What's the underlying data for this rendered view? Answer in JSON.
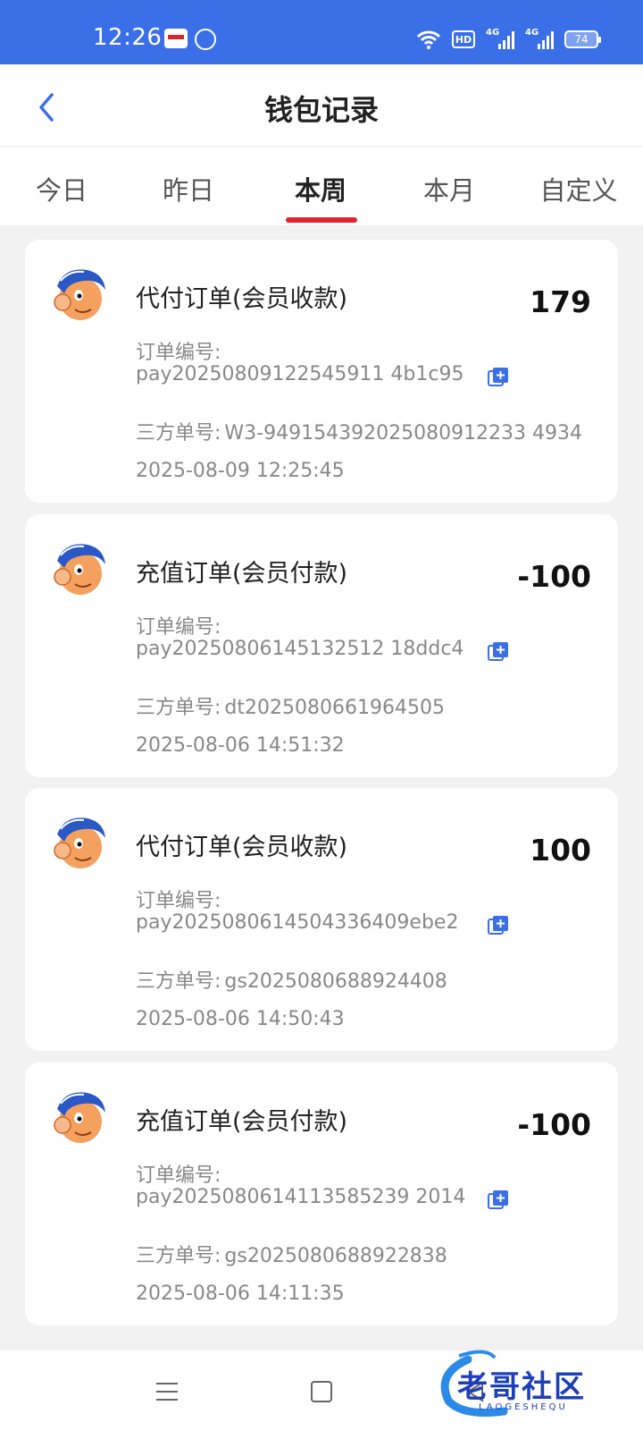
{
  "status_bar": {
    "time": "12:26",
    "hd_label": "HD",
    "network1": "4G",
    "network2": "4G",
    "battery": "74"
  },
  "header": {
    "title": "钱包记录"
  },
  "tabs": [
    {
      "label": "今日",
      "active": false
    },
    {
      "label": "昨日",
      "active": false
    },
    {
      "label": "本周",
      "active": true
    },
    {
      "label": "本月",
      "active": false
    },
    {
      "label": "自定义",
      "active": false
    }
  ],
  "labels": {
    "order_no": "订单编号:",
    "third_party_no": "三方单号:"
  },
  "records": [
    {
      "title": "代付订单(会员收款)",
      "amount": "179",
      "order_no": "pay20250809122545911 4b1c95",
      "third_party_no": "W3-949154392025080912233 4934",
      "time": "2025-08-09 12:25:45"
    },
    {
      "title": "充值订单(会员付款)",
      "amount": "-100",
      "order_no": "pay20250806145132512 18ddc4",
      "third_party_no": "dt2025080661964505",
      "time": "2025-08-06 14:51:32"
    },
    {
      "title": "代付订单(会员收款)",
      "amount": "100",
      "order_no": "pay2025080614504336409ebe2",
      "third_party_no": "gs2025080688924408",
      "time": "2025-08-06 14:50:43"
    },
    {
      "title": "充值订单(会员付款)",
      "amount": "-100",
      "order_no": "pay2025080614113585239 2014",
      "third_party_no": "gs2025080688922838",
      "time": "2025-08-06 14:11:35"
    }
  ],
  "watermark": {
    "text": "老哥社区",
    "sub": "LAOGESHEQU"
  },
  "colors": {
    "status_bar": "#3b6fe8",
    "tab_indicator": "#e0242f",
    "copy_icon": "#3b6fe8"
  }
}
